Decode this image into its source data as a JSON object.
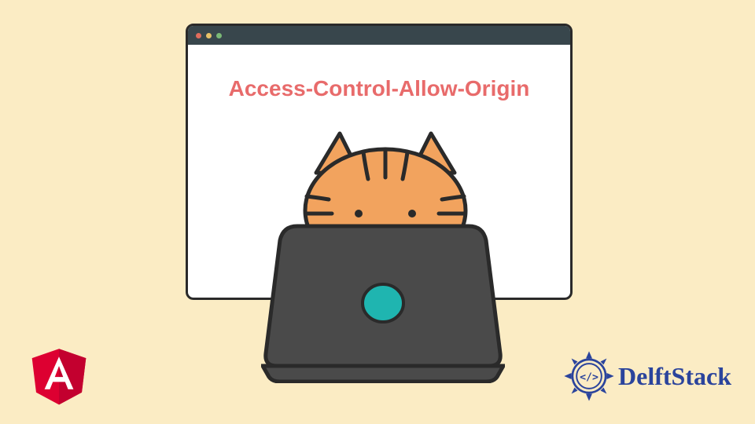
{
  "window": {
    "headline": "Access-Control-Allow-Origin"
  },
  "brand": {
    "name": "DelftStack"
  },
  "colors": {
    "background": "#fbecc4",
    "headline": "#e86b6b",
    "titlebar": "#38464c",
    "angular": "#dd0031",
    "delftstack_blue": "#2b449c",
    "cat_fill": "#f2a35e",
    "laptop_fill": "#4a4a4a",
    "laptop_logo": "#1fb5b0"
  }
}
